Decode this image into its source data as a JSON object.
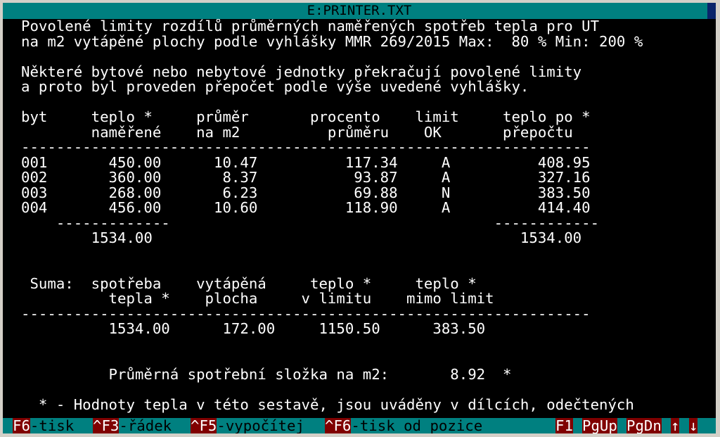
{
  "window": {
    "title": "E:PRINTER.TXT"
  },
  "report": {
    "lines": [
      "Povolené limity rozdílů průměrných naměřených spotřeb tepla pro UT",
      "na m2 vytápěné plochy podle vyhlášky MMR 269/2015 Max:  80 % Min: 200 %",
      "",
      "Některé bytové nebo nebytové jednotky překračují povolené limity",
      "a proto byl proveden přepočet podle výše uvedené vyhlášky.",
      "",
      "byt     teplo *     průměr       procento    limit     teplo po *",
      "        naměřené    na m2          průměru    OK       přepočtu",
      "-----------------------------------------------------------------",
      "001       450.00      10.47          117.34     A          408.95",
      "002       360.00       8.37           93.87     A          327.16",
      "003       268.00       6.23           69.88     N          383.50",
      "004       456.00      10.60          118.90     A          414.40",
      "    -------------                                     ------------",
      "        1534.00                                          1534.00",
      "",
      "",
      " Suma:  spotřeba    vytápěná     teplo *     teplo *",
      "          tepla *    plocha     v limitu    mimo limit",
      "-----------------------------------------------------------------",
      "          1534.00      172.00     1150.50      383.50",
      "",
      "",
      "          Průměrná spotřební složka na m2:       8.92  *",
      "",
      "  * - Hodnoty tepla v této sestavě, jsou uváděny v dílcích, odečtených"
    ]
  },
  "status_bar": {
    "items": [
      {
        "key": "F6",
        "label": "-tisk"
      },
      {
        "key": "^F3",
        "label": "-řádek"
      },
      {
        "key": "^F5",
        "label": "-vypočítej"
      },
      {
        "key": "^F6",
        "label": "-tisk od pozice"
      }
    ],
    "right_keys": [
      "F1",
      "PgUp",
      "PgDn",
      "↑",
      "↓"
    ]
  }
}
